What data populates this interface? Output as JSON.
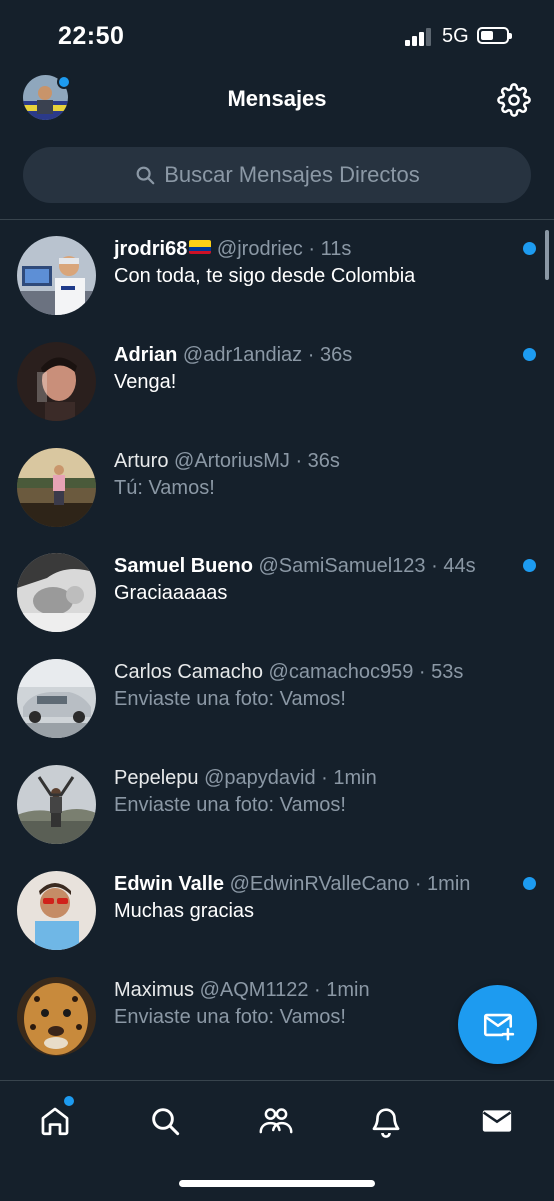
{
  "status_bar": {
    "time": "22:50",
    "network": "5G"
  },
  "header": {
    "title": "Mensajes"
  },
  "search": {
    "placeholder": "Buscar Mensajes Directos"
  },
  "colors": {
    "accent": "#1d9bf0",
    "background": "#15202b",
    "secondary_text": "#8b98a5"
  },
  "conversations": [
    {
      "name": "jrodri68",
      "handle": "@jrodriec",
      "time": "· 11s",
      "message": "Con toda, te sigo desde Colombia",
      "unread": true,
      "flag": "colombia-flag"
    },
    {
      "name": "Adrian",
      "handle": "@adr1andiaz",
      "time": "· 36s",
      "message": "Venga!",
      "unread": true
    },
    {
      "name": "Arturo",
      "handle": "@ArtoriusMJ",
      "time": "· 36s",
      "message": "Tú: Vamos!",
      "unread": false
    },
    {
      "name": "Samuel Bueno",
      "handle": "@SamiSamuel123",
      "time": "· 44s",
      "message": "Graciaaaaas",
      "unread": true
    },
    {
      "name": "Carlos Camacho",
      "handle": "@camachoc959",
      "time": "· 53s",
      "message": "Enviaste una foto: Vamos!",
      "unread": false
    },
    {
      "name": "Pepelepu",
      "handle": "@papydavid",
      "time": "· 1min",
      "message": "Enviaste una foto: Vamos!",
      "unread": false
    },
    {
      "name": "Edwin Valle",
      "handle": "@EdwinRValleCano",
      "time": "· 1min",
      "message": "Muchas gracias",
      "unread": true
    },
    {
      "name": "Maximus",
      "handle": "@AQM1122",
      "time": "· 1min",
      "message": "Enviaste una foto: Vamos!",
      "unread": false
    }
  ],
  "tabs": [
    {
      "icon": "home-icon"
    },
    {
      "icon": "search-icon"
    },
    {
      "icon": "communities-icon"
    },
    {
      "icon": "notifications-icon"
    },
    {
      "icon": "messages-icon"
    }
  ],
  "fab": {
    "icon": "new-message-icon"
  }
}
